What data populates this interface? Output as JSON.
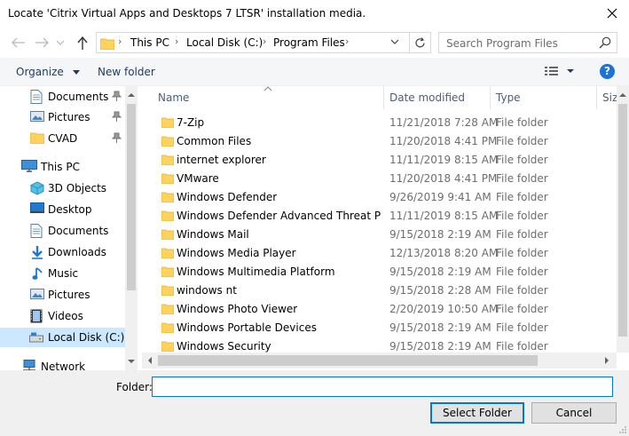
{
  "window": {
    "title": "Locate 'Citrix Virtual Apps and Desktops 7 LTSR' installation media."
  },
  "address": {
    "crumbs": [
      "This PC",
      "Local Disk (C:)",
      "Program Files"
    ]
  },
  "search": {
    "placeholder": "Search Program Files"
  },
  "toolbar": {
    "organize": "Organize",
    "new_folder": "New folder",
    "help": "?"
  },
  "sidebar": {
    "items": [
      {
        "label": "Documents",
        "icon": "documents-icon",
        "pinned": true
      },
      {
        "label": "Pictures",
        "icon": "pictures-icon",
        "pinned": true
      },
      {
        "label": "CVAD",
        "icon": "folder-icon",
        "pinned": true
      },
      {
        "label": "This PC",
        "icon": "this-pc-icon",
        "pinned": false
      },
      {
        "label": "3D Objects",
        "icon": "3d-objects-icon",
        "pinned": false
      },
      {
        "label": "Desktop",
        "icon": "desktop-icon",
        "pinned": false
      },
      {
        "label": "Documents",
        "icon": "documents-icon",
        "pinned": false
      },
      {
        "label": "Downloads",
        "icon": "downloads-icon",
        "pinned": false
      },
      {
        "label": "Music",
        "icon": "music-icon",
        "pinned": false
      },
      {
        "label": "Pictures",
        "icon": "pictures-icon",
        "pinned": false
      },
      {
        "label": "Videos",
        "icon": "videos-icon",
        "pinned": false
      },
      {
        "label": "Local Disk (C:)",
        "icon": "local-disk-icon",
        "pinned": false,
        "selected": true
      },
      {
        "label": "Network",
        "icon": "network-icon",
        "pinned": false
      }
    ]
  },
  "list": {
    "columns": [
      "Name",
      "Date modified",
      "Type",
      "Siz"
    ],
    "rows": [
      {
        "name": "7-Zip",
        "date": "11/21/2018 7:28 AM",
        "type": "File folder"
      },
      {
        "name": "Common Files",
        "date": "11/20/2018 4:41 PM",
        "type": "File folder"
      },
      {
        "name": "internet explorer",
        "date": "11/11/2019 8:15 AM",
        "type": "File folder"
      },
      {
        "name": "VMware",
        "date": "11/20/2018 4:41 PM",
        "type": "File folder"
      },
      {
        "name": "Windows Defender",
        "date": "9/26/2019 9:41 AM",
        "type": "File folder"
      },
      {
        "name": "Windows Defender Advanced Threat Pro...",
        "date": "11/11/2019 8:15 AM",
        "type": "File folder"
      },
      {
        "name": "Windows Mail",
        "date": "9/15/2018 2:19 AM",
        "type": "File folder"
      },
      {
        "name": "Windows Media Player",
        "date": "12/13/2018 8:20 AM",
        "type": "File folder"
      },
      {
        "name": "Windows Multimedia Platform",
        "date": "9/15/2018 2:19 AM",
        "type": "File folder"
      },
      {
        "name": "windows nt",
        "date": "9/15/2018 2:28 AM",
        "type": "File folder"
      },
      {
        "name": "Windows Photo Viewer",
        "date": "2/20/2019 10:50 AM",
        "type": "File folder"
      },
      {
        "name": "Windows Portable Devices",
        "date": "9/15/2018 2:19 AM",
        "type": "File folder"
      },
      {
        "name": "Windows Security",
        "date": "9/15/2018 2:19 AM",
        "type": "File folder"
      }
    ]
  },
  "footer": {
    "folder_label": "Folder:",
    "folder_value": "",
    "select_button": "Select Folder",
    "cancel_button": "Cancel"
  },
  "colors": {
    "accent": "#0078d7",
    "selected": "#cce8ff",
    "folder": "#ffd25c"
  }
}
